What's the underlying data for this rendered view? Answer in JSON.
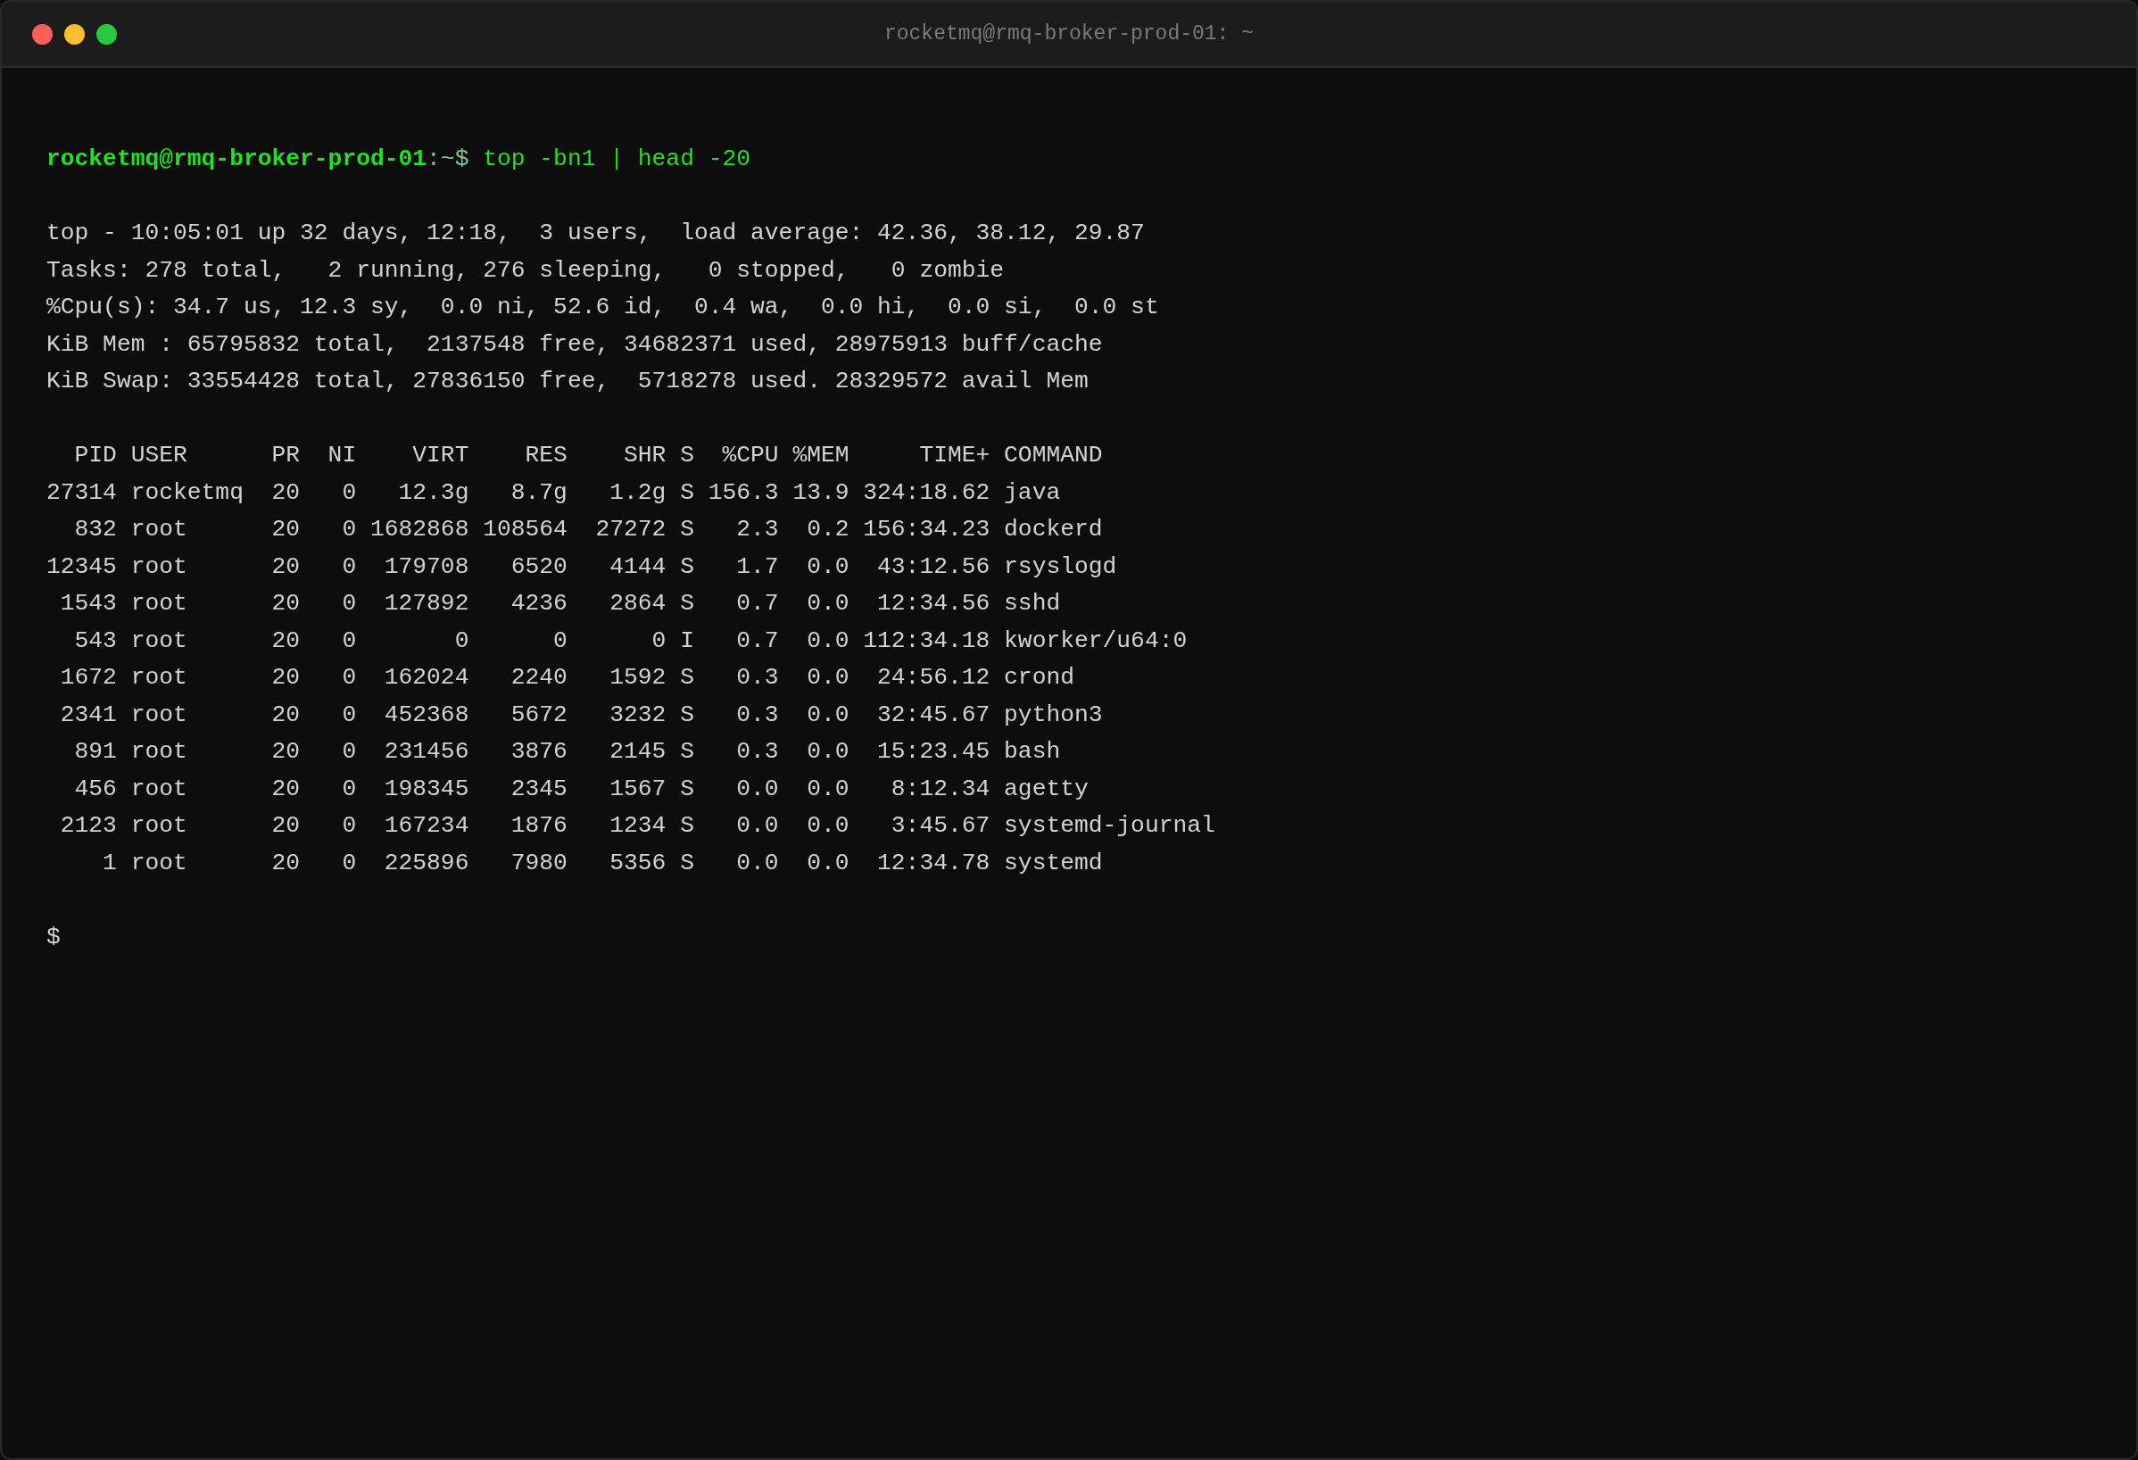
{
  "window": {
    "title": "rocketmq@rmq-broker-prod-01: ~"
  },
  "prompt": {
    "user_host": "rocketmq@rmq-broker-prod-01",
    "path": ":~$",
    "command": "top -bn1 | head -20"
  },
  "summary_lines": [
    "top - 10:05:01 up 32 days, 12:18,  3 users,  load average: 42.36, 38.12, 29.87",
    "Tasks: 278 total,   2 running, 276 sleeping,   0 stopped,   0 zombie",
    "%Cpu(s): 34.7 us, 12.3 sy,  0.0 ni, 52.6 id,  0.4 wa,  0.0 hi,  0.0 si,  0.0 st",
    "KiB Mem : 65795832 total,  2137548 free, 34682371 used, 28975913 buff/cache",
    "KiB Swap: 33554428 total, 27836150 free,  5718278 used. 28329572 avail Mem"
  ],
  "process_header": "  PID USER      PR  NI    VIRT    RES    SHR S  %CPU %MEM     TIME+ COMMAND",
  "process_lines": [
    "27314 rocketmq  20   0   12.3g   8.7g   1.2g S 156.3 13.9 324:18.62 java",
    "  832 root      20   0 1682868 108564  27272 S   2.3  0.2 156:34.23 dockerd",
    "12345 root      20   0  179708   6520   4144 S   1.7  0.0  43:12.56 rsyslogd",
    " 1543 root      20   0  127892   4236   2864 S   0.7  0.0  12:34.56 sshd",
    "  543 root      20   0       0      0      0 I   0.7  0.0 112:34.18 kworker/u64:0",
    " 1672 root      20   0  162024   2240   1592 S   0.3  0.0  24:56.12 crond",
    " 2341 root      20   0  452368   5672   3232 S   0.3  0.0  32:45.67 python3",
    "  891 root      20   0  231456   3876   2145 S   0.3  0.0  15:23.45 bash",
    "  456 root      20   0  198345   2345   1567 S   0.0  0.0   8:12.34 agetty",
    " 2123 root      20   0  167234   1876   1234 S   0.0  0.0   3:45.67 systemd-journal",
    "    1 root      20   0  225896   7980   5356 S   0.0  0.0  12:34.78 systemd"
  ],
  "final_prompt": "$"
}
